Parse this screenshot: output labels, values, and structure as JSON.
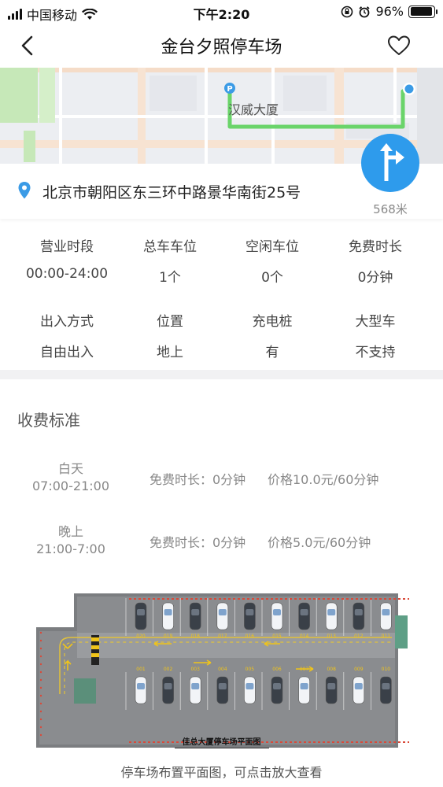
{
  "status_bar": {
    "carrier": "中国移动",
    "time": "下午2:20",
    "battery": "96%",
    "battery_level": 0.96
  },
  "nav": {
    "title": "金台夕照停车场"
  },
  "map": {
    "poi_label": "汉威大厦",
    "route_color": "#6ad46a",
    "parking_marker": "P"
  },
  "address": {
    "text": "北京市朝阳区东三环中路景华南街25号",
    "distance": "568米"
  },
  "info": [
    {
      "label": "营业时段",
      "value": "00:00-24:00"
    },
    {
      "label": "总车车位",
      "value": "1个"
    },
    {
      "label": "空闲车位",
      "value": "0个"
    },
    {
      "label": "免费时长",
      "value": "0分钟"
    },
    {
      "label": "出入方式",
      "value": "自由出入"
    },
    {
      "label": "位置",
      "value": "地上"
    },
    {
      "label": "充电桩",
      "value": "有"
    },
    {
      "label": "大型车",
      "value": "不支持"
    }
  ],
  "fees": {
    "title": "收费标准",
    "rows": [
      {
        "period_name": "白天",
        "period_time": "07:00-21:00",
        "free": "免费时长：0分钟",
        "price": "价格10.0元/60分钟"
      },
      {
        "period_name": "晚上",
        "period_time": "21:00-7:00",
        "free": "免费时长：0分钟",
        "price": "价格5.0元/60分钟"
      }
    ]
  },
  "floorplan": {
    "title": "佳总大厦停车场平面图",
    "top_spots": [
      "020",
      "019",
      "018",
      "017",
      "016",
      "015",
      "014",
      "013",
      "012",
      "011"
    ],
    "bottom_spots": [
      "001",
      "002",
      "003",
      "004",
      "005",
      "006",
      "007",
      "008",
      "009",
      "010"
    ],
    "caption": "停车场布置平面图，可点击放大查看"
  },
  "colors": {
    "accent": "#2e9bec",
    "route": "#6ad46a"
  }
}
